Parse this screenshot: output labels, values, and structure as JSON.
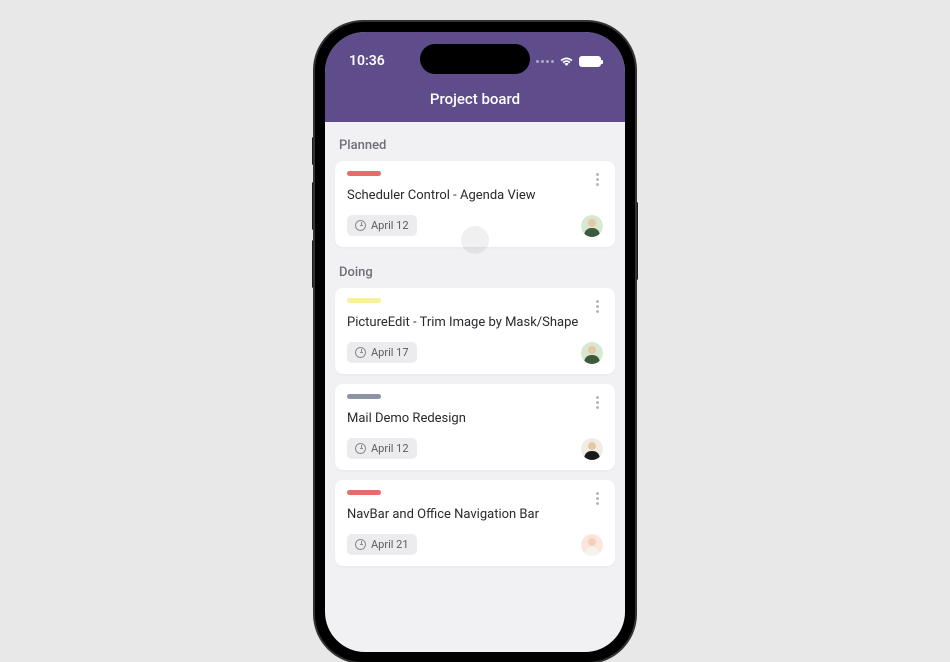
{
  "statusBar": {
    "time": "10:36"
  },
  "header": {
    "title": "Project board"
  },
  "sections": [
    {
      "title": "Planned"
    },
    {
      "title": "Doing"
    }
  ],
  "cards": [
    {
      "title": "Scheduler Control - Agenda View",
      "date": "April 12",
      "color": "#e86b6b",
      "avatar": "green"
    },
    {
      "title": "PictureEdit - Trim Image by Mask/Shape",
      "date": "April 17",
      "color": "#f6f19a",
      "avatar": "green"
    },
    {
      "title": "Mail Demo Redesign",
      "date": "April 12",
      "color": "#8c94a3",
      "avatar": "black"
    },
    {
      "title": "NavBar and Office Navigation Bar",
      "date": "April 21",
      "color": "#e86b6b",
      "avatar": "pink"
    }
  ]
}
